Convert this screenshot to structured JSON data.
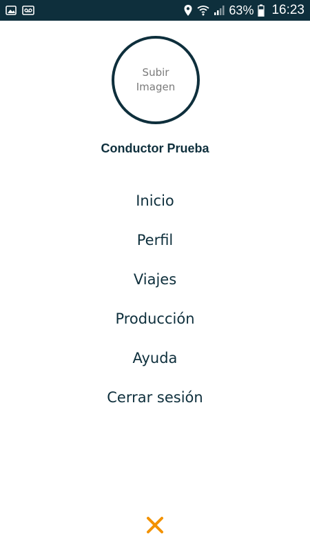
{
  "status_bar": {
    "battery_percent": "63%",
    "time": "16:23",
    "icons": [
      "image-icon",
      "voicemail-icon",
      "location-icon",
      "wifi-icon",
      "signal-icon",
      "battery-icon"
    ]
  },
  "profile": {
    "avatar_line1": "Subir",
    "avatar_line2": "Imagen",
    "name": "Conductor Prueba"
  },
  "menu": {
    "items": [
      {
        "label": "Inicio"
      },
      {
        "label": "Perfil"
      },
      {
        "label": "Viajes"
      },
      {
        "label": "Producción"
      },
      {
        "label": "Ayuda"
      },
      {
        "label": "Cerrar sesión"
      }
    ]
  },
  "colors": {
    "primary": "#0e2f3c",
    "accent": "#f39200",
    "placeholder_text": "#7a7a7a",
    "background": "#ffffff"
  },
  "close_icon": "close-icon"
}
